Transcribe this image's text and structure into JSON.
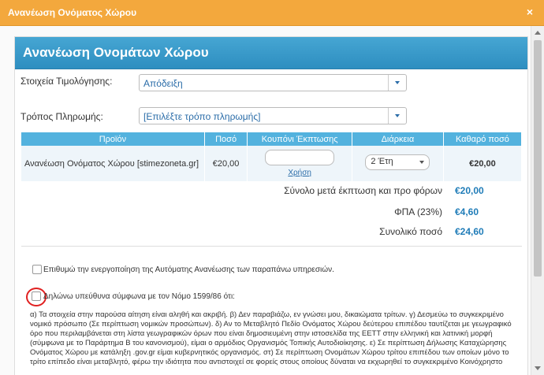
{
  "window": {
    "title": "Ανανέωση Ονόματος Χώρου",
    "close_glyph": "×"
  },
  "panel": {
    "heading": "Ανανέωση Ονομάτων Χώρου"
  },
  "billing": {
    "label": "Στοιχεία Τιμολόγησης:",
    "value": "Απόδειξη"
  },
  "payment": {
    "label": "Τρόπος Πληρωμής:",
    "value": "[Επιλέξτε τρόπο πληρωμής]"
  },
  "table": {
    "headers": [
      "Προϊόν",
      "Ποσό",
      "Κουπόνι Έκπτωσης",
      "Διάρκεια",
      "Καθαρό ποσό"
    ],
    "row": {
      "product": "Ανανέωση Ονόματος Χώρου [stimezoneta.gr]",
      "amount": "€20,00",
      "coupon_link": "Χρήση",
      "duration": "2 Έτη",
      "net": "€20,00"
    }
  },
  "summary": {
    "subtotal_label": "Σύνολο μετά έκπτωση και προ φόρων",
    "subtotal_value": "€20,00",
    "vat_label": "ΦΠΑ (23%)",
    "vat_value": "€4,60",
    "total_label": "Συνολικό ποσό",
    "total_value": "€24,60"
  },
  "auto_renew": {
    "label": "Επιθυμώ την ενεργοποίηση της Αυτόματης Ανανέωσης των παραπάνω υπηρεσιών."
  },
  "declaration": {
    "label": "Δηλώνω υπεύθυνα σύμφωνα με τον Νόμο 1599/86 ότι:",
    "text": "α) Τα στοιχεία στην παρούσα αίτηση είναι αληθή και ακριβή. β) Δεν παραβιάζω, εν γνώσει μου, δικαιώματα τρίτων. γ) Δεσμεύω το συγκεκριμένο νομικό πρόσωπο (Σε περίπτωση νομικών προσώπων). δ) Αν το Μεταβλητό Πεδίο Ονόματος Χώρου δεύτερου επιπέδου ταυτίζεται με γεωγραφικό όρο που περιλαμβάνεται στη λίστα γεωγραφικών όρων που είναι δημοσιευμένη στην ιστοσελίδα της ΕΕΤΤ στην ελληνική και λατινική μορφή (σύμφωνα με το Παράρτημα Β του κανονισμού), είμαι ο αρμόδιος Οργανισμός Τοπικής Αυτοδιοίκησης. ε) Σε περίπτωση Δήλωσης Καταχώρησης Ονόματος Χώρου με κατάληξη .gov.gr είμαι κυβερνητικός οργανισμός. στ) Σε περίπτωση Ονομάτων Χώρου τρίτου επιπέδου των οποίων μόνο το τρίτο επίπεδο είναι μεταβλητό, φέρω την ιδιότητα που αντιστοιχεί σε φορείς στους οποίους δύναται να εκχωρηθεί το συγκεκριμένο Κοινόχρηστο"
  }
}
